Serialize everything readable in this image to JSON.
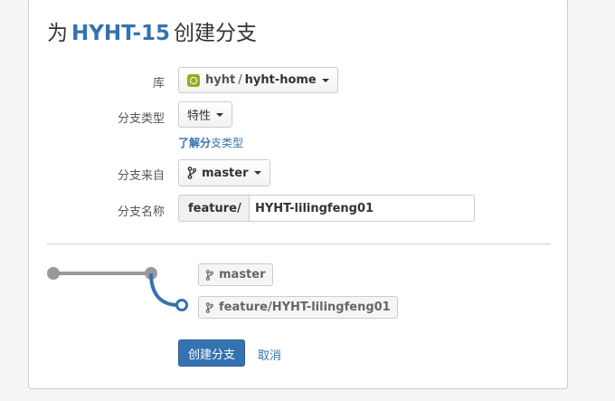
{
  "dialog": {
    "title_prefix": "为",
    "issue_key": "HYHT-15",
    "title_suffix": "创建分支"
  },
  "form": {
    "repository": {
      "label": "库",
      "project": "hyht",
      "separator": "/",
      "repo": "hyht-home"
    },
    "branch_type": {
      "label": "分支类型",
      "value": "特性",
      "help_link_bold": "了解分",
      "help_link_rest": "支类型"
    },
    "branch_from": {
      "label": "分支来自",
      "value": "master"
    },
    "branch_name": {
      "label": "分支名称",
      "prefix": "feature/",
      "value": "HYHT-lilingfeng01"
    }
  },
  "preview": {
    "source_branch": "master",
    "new_branch": "feature/HYHT-lilingfeng01"
  },
  "actions": {
    "create_label": "创建分支",
    "cancel_label": "取消"
  },
  "colors": {
    "brand_blue": "#3572b0",
    "repo_icon_green": "#8eb021",
    "graph_gray": "#999999"
  }
}
